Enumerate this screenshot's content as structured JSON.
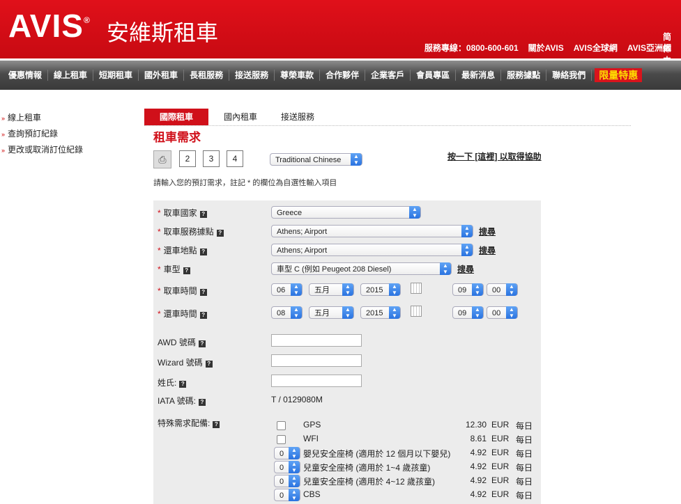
{
  "header": {
    "logo": "AVIS",
    "reg": "®",
    "logo_cn": "安維斯租車",
    "lang": "简体中文",
    "hotline": "服務專線：0800-600-601",
    "links": [
      "關於AVIS",
      "AVIS全球網",
      "AVIS亞洲網"
    ]
  },
  "nav": [
    "優惠情報",
    "線上租車",
    "短期租車",
    "國外租車",
    "長租服務",
    "接送服務",
    "尊榮車款",
    "合作夥伴",
    "企業客戶",
    "會員專區",
    "最新消息",
    "服務據點",
    "聯絡我們"
  ],
  "nav_promo": "限量特惠",
  "sidebar": [
    "線上租車",
    "查詢預訂紀錄",
    "更改或取消訂位紀錄"
  ],
  "tabs": [
    "國際租車",
    "國內租車",
    "接送服務"
  ],
  "page_title": "租車需求",
  "font_sizes": [
    "2",
    "3",
    "4"
  ],
  "language": "Traditional Chinese",
  "help": "按一下 [這裡] 以取得協助",
  "instruction": "請輸入您的預訂需求，註記 * 的欄位為自選性輸入項目",
  "form": {
    "pickup_country_label": "取車國家",
    "pickup_country": "Greece",
    "pickup_location_label": "取車服務據點",
    "pickup_location": "Athens; Airport",
    "return_location_label": "還車地點",
    "return_location": "Athens; Airport",
    "car_type_label": "車型",
    "car_type": "車型 C (例如 Peugeot 208 Diesel)",
    "search": "搜尋",
    "pickup_time_label": "取車時間",
    "pickup_day": "06",
    "pickup_month": "五月",
    "pickup_year": "2015",
    "pickup_hour": "09",
    "pickup_min": "00",
    "return_time_label": "還車時間",
    "return_day": "08",
    "return_month": "五月",
    "return_year": "2015",
    "return_hour": "09",
    "return_min": "00",
    "awd_label": "AWD 號碼",
    "wizard_label": "Wizard 號碼",
    "surname_label": "姓氏:",
    "iata_label": "IATA 號碼:",
    "iata_value": "T / 0129080M",
    "extras_label": "特殊需求配備:"
  },
  "extras": [
    {
      "control": "checkbox",
      "name": "GPS",
      "price": "12.30",
      "currency": "EUR",
      "unit": "每日"
    },
    {
      "control": "checkbox",
      "name": "WFI",
      "price": "8.61",
      "currency": "EUR",
      "unit": "每日"
    },
    {
      "control": "select",
      "qty": "0",
      "name": "嬰兒安全座椅 (適用於 12 個月以下嬰兒)",
      "price": "4.92",
      "currency": "EUR",
      "unit": "每日"
    },
    {
      "control": "select",
      "qty": "0",
      "name": "兒童安全座椅 (適用於 1~4 歲孩童)",
      "price": "4.92",
      "currency": "EUR",
      "unit": "每日"
    },
    {
      "control": "select",
      "qty": "0",
      "name": "兒童安全座椅 (適用於 4~12 歲孩童)",
      "price": "4.92",
      "currency": "EUR",
      "unit": "每日"
    },
    {
      "control": "select",
      "qty": "0",
      "name": "CBS",
      "price": "4.92",
      "currency": "EUR",
      "unit": "每日"
    }
  ],
  "colors": {
    "brand_red": "#d0101a",
    "nav_dark": "#3a3a3a",
    "select_blue": "#2a73e0"
  }
}
